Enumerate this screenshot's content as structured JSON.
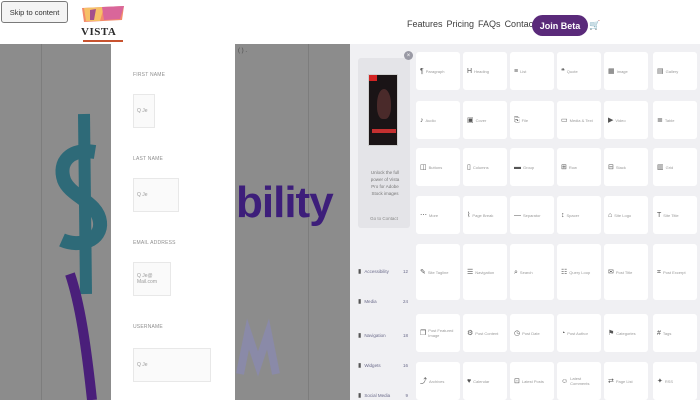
{
  "header": {
    "skip_link": "Skip to content",
    "logo_text": "VISTA",
    "nav": [
      "Features",
      "Pricing",
      "FAQs",
      "Contact"
    ],
    "join_button": "Join Beta",
    "cart_icon": "cart-icon"
  },
  "form": {
    "fields": [
      {
        "label": "FIRST NAME",
        "value": "Q Je"
      },
      {
        "label": "LAST NAME",
        "value": "Q Je"
      },
      {
        "label": "EMAIL ADDRESS",
        "value": "Q Je@ Mail.com"
      },
      {
        "label": "USERNAME",
        "value": "Q Je"
      }
    ]
  },
  "background": {
    "caption": "( ) .",
    "word_fragment": "bility"
  },
  "editor_panel": {
    "banner": {
      "close": "×",
      "text": "Unlock the full power of Vista Pro for Adobe Stock images",
      "link": "Go to Contact"
    },
    "side_items": [
      {
        "label": "Accessibility",
        "count": "12"
      },
      {
        "label": "Media",
        "count": "24"
      },
      {
        "label": "Navigation",
        "count": "18"
      },
      {
        "label": "Widgets",
        "count": "16"
      },
      {
        "label": "Social Media",
        "count": "9"
      }
    ],
    "blocks": [
      {
        "icon": "¶",
        "label": "Paragraph"
      },
      {
        "icon": "H",
        "label": "Heading"
      },
      {
        "icon": "≡",
        "label": "List"
      },
      {
        "icon": "❝",
        "label": "Quote"
      },
      {
        "icon": "▦",
        "label": "Image"
      },
      {
        "icon": "▤",
        "label": "Gallery"
      },
      {
        "icon": "♪",
        "label": "Audio"
      },
      {
        "icon": "▣",
        "label": "Cover"
      },
      {
        "icon": "⎘",
        "label": "File"
      },
      {
        "icon": "▭",
        "label": "Media & Text"
      },
      {
        "icon": "▶",
        "label": "Video"
      },
      {
        "icon": "≣",
        "label": "Table"
      },
      {
        "icon": "◫",
        "label": "Buttons"
      },
      {
        "icon": "▯",
        "label": "Columns"
      },
      {
        "icon": "▬",
        "label": "Group"
      },
      {
        "icon": "⊞",
        "label": "Row"
      },
      {
        "icon": "⊟",
        "label": "Stack"
      },
      {
        "icon": "▥",
        "label": "Grid"
      },
      {
        "icon": "⋯",
        "label": "More"
      },
      {
        "icon": "⌇",
        "label": "Page Break"
      },
      {
        "icon": "—",
        "label": "Separator"
      },
      {
        "icon": "↕",
        "label": "Spacer"
      },
      {
        "icon": "⌂",
        "label": "Site Logo"
      },
      {
        "icon": "T",
        "label": "Site Title"
      },
      {
        "icon": "✎",
        "label": "Site Tagline"
      },
      {
        "icon": "☰",
        "label": "Navigation"
      },
      {
        "icon": "⌕",
        "label": "Search"
      },
      {
        "icon": "☷",
        "label": "Query Loop"
      },
      {
        "icon": "✉",
        "label": "Post Title"
      },
      {
        "icon": "⌗",
        "label": "Post Excerpt"
      },
      {
        "icon": "❐",
        "label": "Post Featured Image"
      },
      {
        "icon": "⚙",
        "label": "Post Content"
      },
      {
        "icon": "◷",
        "label": "Post Date"
      },
      {
        "icon": "◔",
        "label": "Post Author"
      },
      {
        "icon": "⚑",
        "label": "Categories"
      },
      {
        "icon": "#",
        "label": "Tags"
      },
      {
        "icon": "⤴",
        "label": "Archives"
      },
      {
        "icon": "♥",
        "label": "Calendar"
      },
      {
        "icon": "⊡",
        "label": "Latest Posts"
      },
      {
        "icon": "☺",
        "label": "Latest Comments"
      },
      {
        "icon": "⇄",
        "label": "Page List"
      },
      {
        "icon": "✦",
        "label": "RSS"
      }
    ]
  }
}
